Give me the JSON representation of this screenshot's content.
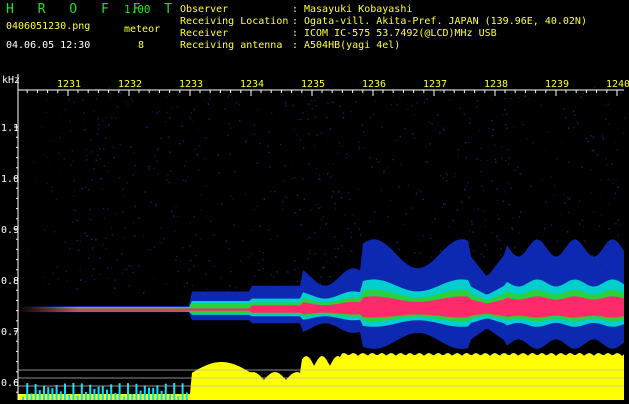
{
  "header": {
    "app_title": "H R O F F T",
    "app_version": "1.00",
    "filename": "0406051230.png",
    "datetime": "04.06.05 12:30",
    "meteor_label": "meteor",
    "meteor_count": "8",
    "info": [
      {
        "key": "Observer",
        "value": "Masayuki Kobayashi"
      },
      {
        "key": "Receiving Location",
        "value": "Ogata-vill. Akita-Pref. JAPAN (139.96E, 40.02N)"
      },
      {
        "key": "Receiver",
        "value": "ICOM IC-575 53.7492(@LCD)MHz USB"
      },
      {
        "key": "Receiving antenna",
        "value": "A504HB(yagi 4el)"
      }
    ]
  },
  "plot": {
    "y_unit": "kHz",
    "y_ticks": [
      "1.1",
      "1.0",
      "0.9",
      "0.8",
      "0.7",
      "0.6"
    ],
    "x_ticks": [
      "1231",
      "1232",
      "1233",
      "1234",
      "1235",
      "1236",
      "1237",
      "1238",
      "1239",
      "1240"
    ],
    "colors": {
      "axis": "#ffffff",
      "tick_label": "#ffffff",
      "x_label": "#ffff3a",
      "noise": "#2a2a9a",
      "signal_outer": "#1030d0",
      "signal_mid": "#00e0d0",
      "signal_green": "#30d030",
      "signal_core": "#ff2a6a",
      "level": "#ffff00",
      "level_cyan": "#00e5ff"
    }
  }
}
